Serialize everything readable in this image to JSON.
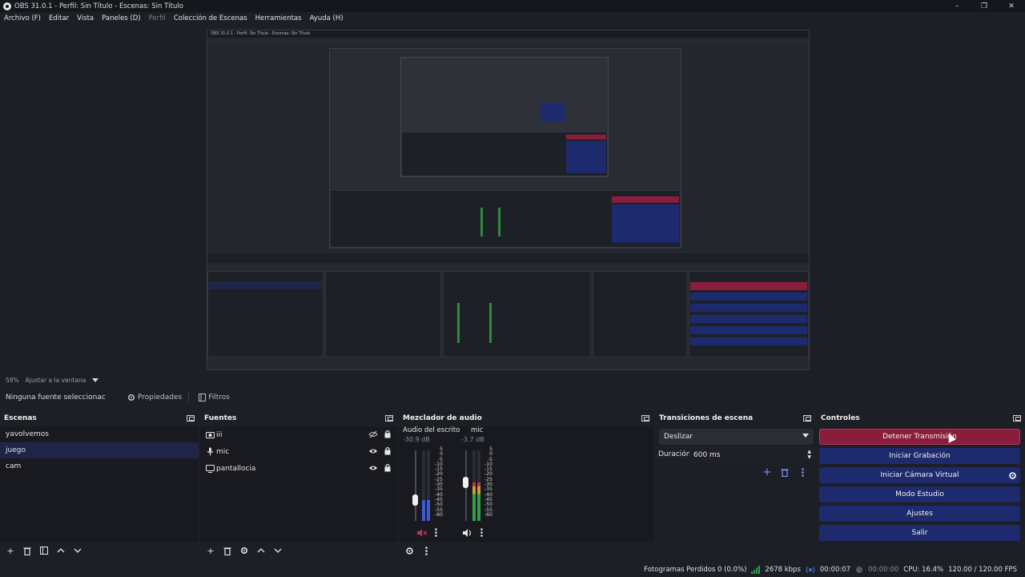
{
  "window": {
    "title": "OBS 31.0.1 - Perfil: Sin Título - Escenas: Sin Título",
    "minimize": "–",
    "maximize": "❐",
    "close": "✕"
  },
  "menu": [
    {
      "label": "Archivo (F)",
      "disabled": false
    },
    {
      "label": "Editar",
      "disabled": false
    },
    {
      "label": "Vista",
      "disabled": false
    },
    {
      "label": "Paneles (D)",
      "disabled": false
    },
    {
      "label": "Perfil",
      "disabled": true
    },
    {
      "label": "Colección de Escenas",
      "disabled": false
    },
    {
      "label": "Herramientas",
      "disabled": false
    },
    {
      "label": "Ayuda (H)",
      "disabled": false
    }
  ],
  "preview": {
    "zoom": "58%",
    "fit_label": "Ajustar a la ventana"
  },
  "source_toolbar": {
    "no_source": "Ninguna fuente seleccionac",
    "properties": "Propiedades",
    "filters": "Filtros"
  },
  "scenes": {
    "title": "Escenas",
    "items": [
      {
        "label": "yavolvemos",
        "selected": false
      },
      {
        "label": "juego",
        "selected": true
      },
      {
        "label": "cam",
        "selected": false
      }
    ]
  },
  "sources": {
    "title": "Fuentes",
    "items": [
      {
        "label": "iii",
        "icon": "camera-icon",
        "visible": false
      },
      {
        "label": "mic",
        "icon": "microphone-icon",
        "visible": true
      },
      {
        "label": "pantallocia",
        "icon": "monitor-icon",
        "visible": true
      }
    ]
  },
  "mixer": {
    "title": "Mezclador de audio",
    "channels": [
      {
        "name": "Audio del escrito",
        "db": "-30.9 dB",
        "level": 0.3,
        "muted": true
      },
      {
        "name": "mic",
        "db": "-3.7 dB",
        "level": 0.55,
        "muted": false
      }
    ],
    "scale": [
      "5",
      "0",
      "-5",
      "-10",
      "-15",
      "-20",
      "-25",
      "-30",
      "-35",
      "-40",
      "-45",
      "-50",
      "-55",
      "-60"
    ]
  },
  "transitions": {
    "title": "Transiciones de escena",
    "selected": "Deslizar",
    "duration_label": "Duración",
    "duration_value": "600 ms"
  },
  "controls": {
    "title": "Controles",
    "buttons": [
      {
        "label": "Detener Transmisión",
        "active": true
      },
      {
        "label": "Iniciar Grabación",
        "active": false
      },
      {
        "label": "Iniciar Cámara Virtual",
        "active": false
      },
      {
        "label": "Modo Estudio",
        "active": false
      },
      {
        "label": "Ajustes",
        "active": false
      },
      {
        "label": "Salir",
        "active": false
      }
    ]
  },
  "status": {
    "dropped_frames": "Fotogramas Perdidos 0 (0.0%)",
    "bitrate": "2678 kbps",
    "stream_time": "00:00:07",
    "record_time": "00:00:00",
    "cpu": "CPU: 16.4%",
    "fps": "120.00 / 120.00 FPS"
  },
  "colors": {
    "accent_active": "#8a1d3b",
    "button_blue": "#1e2a6e",
    "selection": "#1f2549",
    "meter_green": "#2ea043"
  }
}
